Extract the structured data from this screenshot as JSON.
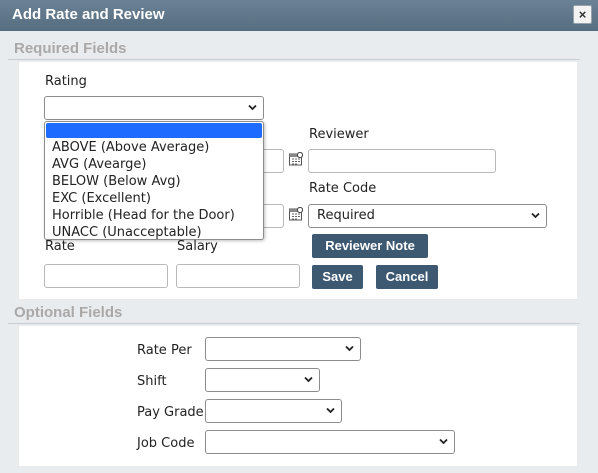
{
  "window": {
    "title": "Add Rate and Review",
    "close_glyph": "×"
  },
  "required": {
    "heading": "Required Fields",
    "rating_label": "Rating",
    "rating_value": "",
    "rating_options": [
      "",
      "ABOVE (Above Average)",
      "AVG (Avearge)",
      "BELOW (Below Avg)",
      "EXC (Excellent)",
      "Horrible (Head for the Door)",
      "UNACC (Unacceptable)"
    ],
    "reviewer_label": "Reviewer",
    "reviewer_value": "",
    "rate_code_label": "Rate Code",
    "rate_code_value": "Required",
    "rate_label": "Rate",
    "salary_label": "Salary",
    "reviewer_note_button": "Reviewer Note",
    "save_button": "Save",
    "cancel_button": "Cancel"
  },
  "optional": {
    "heading": "Optional Fields",
    "rate_per_label": "Rate Per",
    "shift_label": "Shift",
    "pay_grade_label": "Pay Grade",
    "job_code_label": "Job Code"
  },
  "colors": {
    "titlebar": "#5f778b",
    "button": "#3d5871",
    "dropdown_highlight": "#1e6bff"
  },
  "icons": [
    "close-icon",
    "calendar-icon",
    "chevron-down-icon"
  ]
}
